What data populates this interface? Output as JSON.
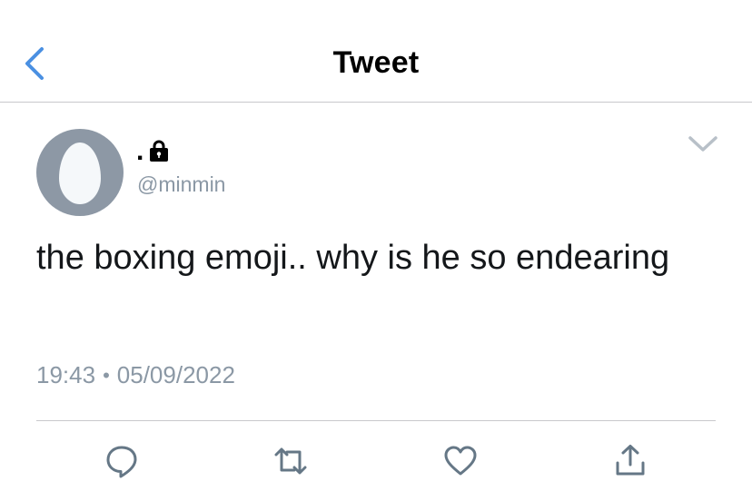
{
  "nav": {
    "title": "Tweet",
    "back_icon": "chevron-left-icon",
    "accent_color": "#1da1f2"
  },
  "tweet": {
    "display_name": ".",
    "handle": "@minmin",
    "protected_icon": "lock-icon",
    "text": "the boxing emoji.. why is he so endearing",
    "time": "19:43",
    "separator": "•",
    "date": "05/09/2022"
  },
  "actions": [
    {
      "name": "reply",
      "icon": "reply-icon"
    },
    {
      "name": "retweet",
      "icon": "retweet-icon"
    },
    {
      "name": "like",
      "icon": "heart-icon"
    },
    {
      "name": "share",
      "icon": "share-icon"
    }
  ],
  "colors": {
    "secondary_text": "#8b98a5",
    "icon_gray": "#657786",
    "avatar_bg": "#8d98a5"
  }
}
